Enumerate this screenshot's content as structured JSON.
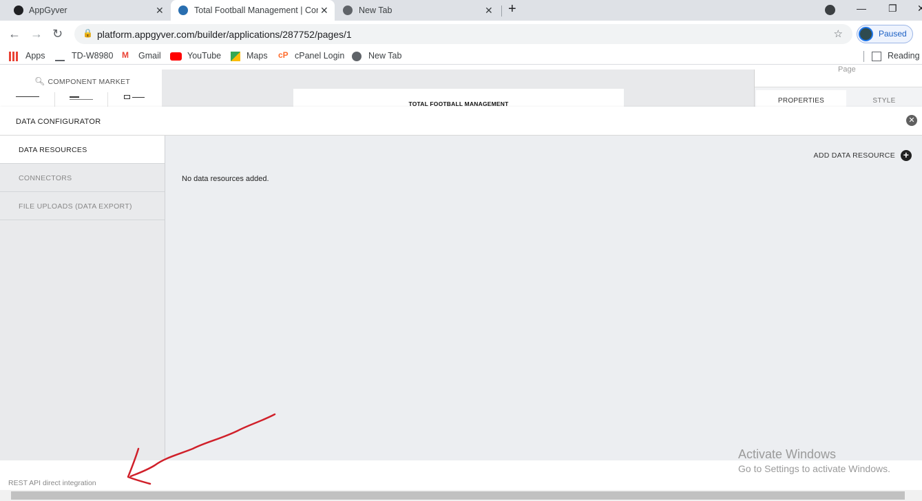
{
  "browser": {
    "tabs": [
      {
        "title": "AppGyver",
        "favicon": "appgyver-icon",
        "active": false
      },
      {
        "title": "Total Football Management | Cor",
        "favicon": "appgyver-icon",
        "active": true
      },
      {
        "title": "New Tab",
        "favicon": "chrome-icon",
        "active": false
      }
    ],
    "url": "platform.appgyver.com/builder/applications/287752/pages/1",
    "profile_label": "Paused",
    "bookmarks": [
      {
        "label": "Apps",
        "icon": "apps-grid-icon"
      },
      {
        "label": "TD-W8980",
        "icon": "router-icon"
      },
      {
        "label": "Gmail",
        "icon": "gmail-icon"
      },
      {
        "label": "YouTube",
        "icon": "youtube-icon"
      },
      {
        "label": "Maps",
        "icon": "maps-icon"
      },
      {
        "label": "cPanel Login",
        "icon": "cpanel-icon"
      },
      {
        "label": "New Tab",
        "icon": "globe-icon"
      }
    ],
    "reading_list": "Reading l"
  },
  "builder": {
    "component_market": "COMPONENT MARKET",
    "canvas_title": "TOTAL FOOTBALL MANAGEMENT",
    "right_panel": {
      "page_label": "Page",
      "tabs": [
        "PROPERTIES",
        "STYLE"
      ]
    }
  },
  "modal": {
    "title": "DATA CONFIGURATOR",
    "sidebar": [
      {
        "label": "DATA RESOURCES",
        "active": true
      },
      {
        "label": "CONNECTORS",
        "active": false
      },
      {
        "label": "FILE UPLOADS (DATA EXPORT)",
        "active": false
      }
    ],
    "add_button": "ADD DATA RESOURCE",
    "empty_message": "No data resources added."
  },
  "below_modal": {
    "rest_text": "REST API direct integration"
  },
  "windows_watermark": {
    "line1": "Activate Windows",
    "line2": "Go to Settings to activate Windows."
  },
  "colors": {
    "annotation_arrow": "#d0202a",
    "accent_blue": "#1a73e8"
  }
}
